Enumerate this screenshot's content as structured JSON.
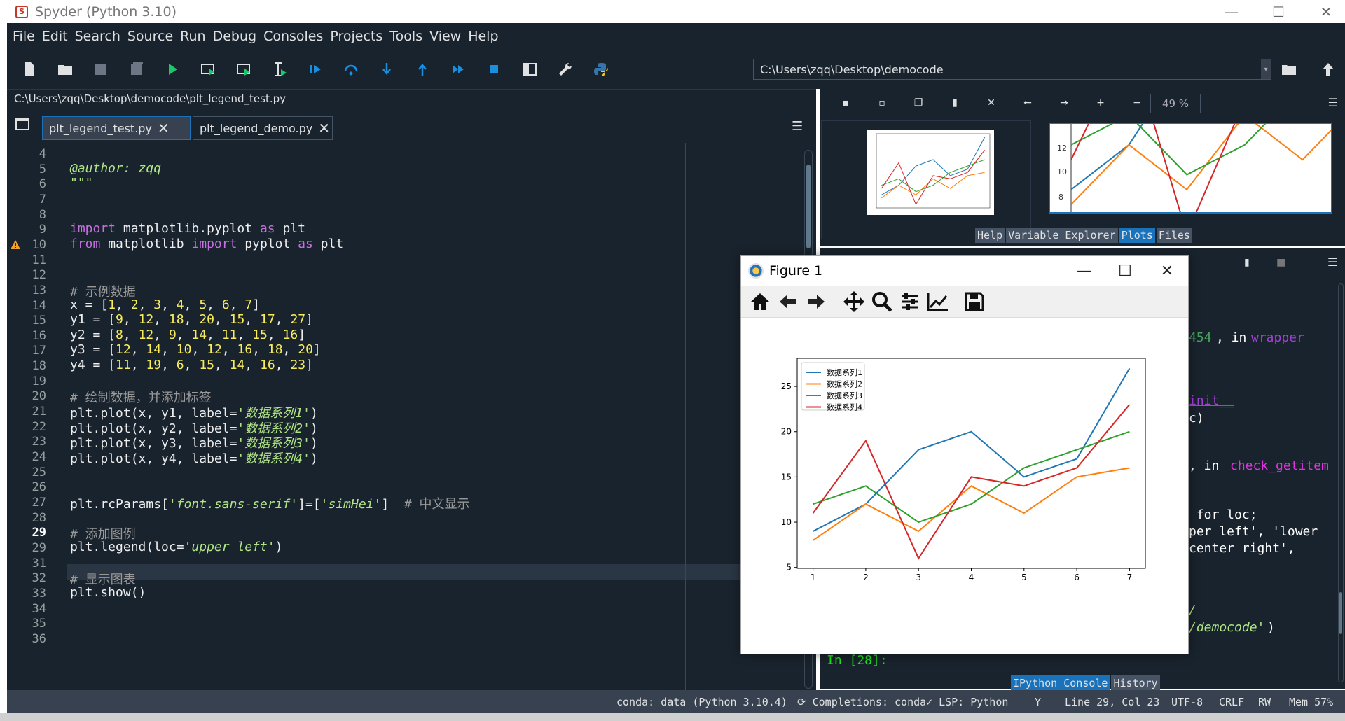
{
  "window": {
    "title": "Spyder (Python 3.10)",
    "logo": "Spyder",
    "controls": {
      "minimize": "—",
      "maximize": "☐",
      "close": "✕"
    }
  },
  "menu": [
    "File",
    "Edit",
    "Search",
    "Source",
    "Run",
    "Debug",
    "Consoles",
    "Projects",
    "Tools",
    "View",
    "Help"
  ],
  "toolbar": {
    "icons": [
      "new-file-icon",
      "open-file-icon",
      "save-icon",
      "save-all-icon",
      "run-icon",
      "run-cell-icon",
      "run-cell-advance-icon",
      "run-selection-icon",
      "debug-icon",
      "step-over-icon",
      "step-into-icon",
      "step-return-icon",
      "continue-icon",
      "stop-icon",
      "maximize-pane-icon",
      "preferences-icon",
      "python-path-icon"
    ],
    "working_dir": "C:\\Users\\zqq\\Desktop\\democode"
  },
  "editor": {
    "filepath": "C:\\Users\\zqq\\Desktop\\democode\\plt_legend_test.py",
    "tabs": [
      {
        "label": "plt_legend_test.py",
        "active": true
      },
      {
        "label": "plt_legend_demo.py",
        "active": false
      }
    ],
    "current_line": "29",
    "warning_line": "10",
    "lines": [
      {
        "n": "4",
        "html": ""
      },
      {
        "n": "5",
        "html": "<span class='str'>@author: zqq</span>"
      },
      {
        "n": "6",
        "html": "<span class='str'>\"\"\"</span>"
      },
      {
        "n": "7",
        "html": ""
      },
      {
        "n": "8",
        "html": ""
      },
      {
        "n": "9",
        "html": "<span class='kw'>import</span> matplotlib.pyplot <span class='kw'>as</span> plt"
      },
      {
        "n": "10",
        "html": "<span class='kw'>from</span> matplotlib <span class='kw'>import</span> pyplot <span class='kw'>as</span> plt"
      },
      {
        "n": "11",
        "html": ""
      },
      {
        "n": "12",
        "html": ""
      },
      {
        "n": "13",
        "html": "<span class='cm'># 示例数据</span>"
      },
      {
        "n": "14",
        "html": "x = [<span class='num'>1</span>, <span class='num'>2</span>, <span class='num'>3</span>, <span class='num'>4</span>, <span class='num'>5</span>, <span class='num'>6</span>, <span class='num'>7</span>]"
      },
      {
        "n": "15",
        "html": "y1 = [<span class='num'>9</span>, <span class='num'>12</span>, <span class='num'>18</span>, <span class='num'>20</span>, <span class='num'>15</span>, <span class='num'>17</span>, <span class='num'>27</span>]"
      },
      {
        "n": "16",
        "html": "y2 = [<span class='num'>8</span>, <span class='num'>12</span>, <span class='num'>9</span>, <span class='num'>14</span>, <span class='num'>11</span>, <span class='num'>15</span>, <span class='num'>16</span>]"
      },
      {
        "n": "17",
        "html": "y3 = [<span class='num'>12</span>, <span class='num'>14</span>, <span class='num'>10</span>, <span class='num'>12</span>, <span class='num'>16</span>, <span class='num'>18</span>, <span class='num'>20</span>]"
      },
      {
        "n": "18",
        "html": "y4 = [<span class='num'>11</span>, <span class='num'>19</span>, <span class='num'>6</span>, <span class='num'>15</span>, <span class='num'>14</span>, <span class='num'>16</span>, <span class='num'>23</span>]"
      },
      {
        "n": "19",
        "html": ""
      },
      {
        "n": "20",
        "html": "<span class='cm'># 绘制数据，并添加标签</span>"
      },
      {
        "n": "21",
        "html": "plt.plot(x, y1, label=<span class='str'>'数据系列1'</span>)"
      },
      {
        "n": "22",
        "html": "plt.plot(x, y2, label=<span class='str'>'数据系列2'</span>)"
      },
      {
        "n": "23",
        "html": "plt.plot(x, y3, label=<span class='str'>'数据系列3'</span>)"
      },
      {
        "n": "24",
        "html": "plt.plot(x, y4, label=<span class='str'>'数据系列4'</span>)"
      },
      {
        "n": "25",
        "html": ""
      },
      {
        "n": "26",
        "html": ""
      },
      {
        "n": "27",
        "html": "plt.rcParams[<span class='str'>'font.sans-serif'</span>]=[<span class='str'>'simHei'</span>]  <span class='cm'># 中文显示</span>"
      },
      {
        "n": "28",
        "html": ""
      },
      {
        "n": "29",
        "html": "<span class='cm'># 添加图例</span>"
      },
      {
        "n": "29",
        "html": "plt.legend(loc=<span class='str'>'upper left'</span>)"
      },
      {
        "n": "31",
        "html": ""
      },
      {
        "n": "32",
        "html": "<span class='cm'># 显示图表</span>"
      },
      {
        "n": "33",
        "html": "plt.show()"
      },
      {
        "n": "34",
        "html": ""
      },
      {
        "n": "35",
        "html": ""
      },
      {
        "n": "36",
        "html": ""
      }
    ]
  },
  "plots_pane": {
    "zoom": "49 %",
    "tabs": [
      "Help",
      "Variable Explorer",
      "Plots",
      "Files"
    ],
    "active_tab": "Plots",
    "preview_ticks": [
      "12",
      "10",
      "8"
    ]
  },
  "console": {
    "fragments": [
      {
        "id": "c1",
        "text": "454",
        "color": "#46a35a"
      },
      {
        "id": "c2",
        "text": ", in ",
        "color": "#ffffff"
      },
      {
        "id": "c3",
        "text": "wrapper",
        "color": "#a43fd9"
      },
      {
        "id": "c4",
        "text": "init__",
        "color": "#a43fd9"
      },
      {
        "id": "c5",
        "text": "c)",
        "color": "#ffffff"
      },
      {
        "id": "c6",
        "text": ", in ",
        "color": "#ffffff"
      },
      {
        "id": "c7",
        "text": "check_getitem",
        "color": "#e233e2"
      },
      {
        "id": "c8",
        "text": " for loc;",
        "color": "#ffffff"
      },
      {
        "id": "c9",
        "text": "per left', 'lower",
        "color": "#ffffff"
      },
      {
        "id": "c10",
        "text": "center right',",
        "color": "#ffffff"
      },
      {
        "id": "c11",
        "text": "/",
        "color": "#b0e686"
      },
      {
        "id": "c12",
        "text": "/democode'",
        "color": "#b0e686"
      },
      {
        "id": "c13",
        "text": ")",
        "color": "#ffffff"
      }
    ],
    "prompt": "In [28]:",
    "tabs": [
      "IPython Console",
      "History"
    ],
    "active_tab": "IPython Console"
  },
  "statusbar": {
    "env": "conda: data (Python 3.10.4)",
    "completions": "Completions: conda",
    "lsp": "LSP: Python",
    "git": "Y",
    "position": "Line 29, Col 23",
    "encoding": "UTF-8",
    "eol": "CRLF",
    "perms": "RW",
    "mem": "Mem 57%"
  },
  "figure": {
    "title": "Figure 1",
    "toolbar_icons": [
      "home-icon",
      "back-icon",
      "forward-icon",
      "pan-icon",
      "zoom-icon",
      "configure-subplots-icon",
      "edit-axis-icon",
      "save-figure-icon"
    ]
  },
  "chart_data": {
    "type": "line",
    "x": [
      1,
      2,
      3,
      4,
      5,
      6,
      7
    ],
    "series": [
      {
        "name": "数据系列1",
        "values": [
          9,
          12,
          18,
          20,
          15,
          17,
          27
        ],
        "color": "#1f77b4"
      },
      {
        "name": "数据系列2",
        "values": [
          8,
          12,
          9,
          14,
          11,
          15,
          16
        ],
        "color": "#ff7f0e"
      },
      {
        "name": "数据系列3",
        "values": [
          12,
          14,
          10,
          12,
          16,
          18,
          20
        ],
        "color": "#2ca02c"
      },
      {
        "name": "数据系列4",
        "values": [
          11,
          19,
          6,
          15,
          14,
          16,
          23
        ],
        "color": "#d62728"
      }
    ],
    "xticks": [
      1,
      2,
      3,
      4,
      5,
      6,
      7
    ],
    "yticks": [
      5,
      10,
      15,
      20,
      25
    ],
    "xlim": [
      0.7,
      7.3
    ],
    "ylim": [
      4.9,
      28.1
    ],
    "legend": "upper left",
    "grid": false,
    "title": "",
    "xlabel": "",
    "ylabel": ""
  }
}
